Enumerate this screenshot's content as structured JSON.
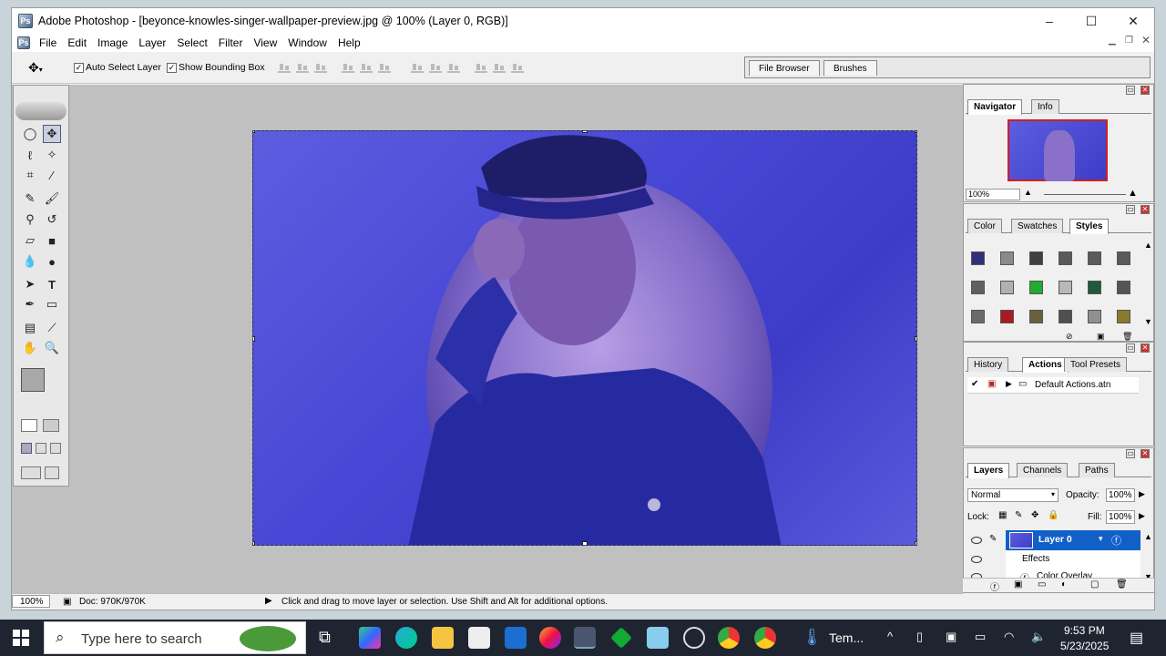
{
  "window": {
    "title": "Adobe Photoshop - [beyonce-knowles-singer-wallpaper-preview.jpg @ 100% (Layer 0, RGB)]",
    "controls": {
      "minimize": "–",
      "maximize": "☐",
      "close": "✕"
    }
  },
  "menu": [
    "File",
    "Edit",
    "Image",
    "Layer",
    "Select",
    "Filter",
    "View",
    "Window",
    "Help"
  ],
  "options": {
    "auto_select_layer": "Auto Select Layer",
    "show_bounding_box": "Show Bounding Box",
    "auto_select_checked": true,
    "show_bbox_checked": true
  },
  "palette_well": {
    "tabs": [
      "File Browser",
      "Brushes"
    ]
  },
  "navigator": {
    "tabs": [
      "Navigator",
      "Info"
    ],
    "zoom": "100%"
  },
  "styles_panel": {
    "tabs": [
      "Color",
      "Swatches",
      "Styles"
    ],
    "swatch_colors": [
      "#30307a",
      "#8a8a8a",
      "#404040",
      "#5a5a5a",
      "#5a5a5a",
      "#5a5a5a",
      "#606060",
      "#b0b0b0",
      "#22aa33",
      "#b8b8b8",
      "#1f5a3a",
      "#555555",
      "#6a6a6a",
      "#aa1a22",
      "#6a6040",
      "#505050",
      "#909090",
      "#8a7a30"
    ]
  },
  "history_panel": {
    "tabs": [
      "History",
      "Actions",
      "Tool Presets"
    ],
    "action_set": "Default Actions.atn"
  },
  "layers_panel": {
    "tabs": [
      "Layers",
      "Channels",
      "Paths"
    ],
    "blend_mode": "Normal",
    "opacity_label": "Opacity:",
    "opacity": "100%",
    "lock_label": "Lock:",
    "fill_label": "Fill:",
    "fill": "100%",
    "layer_name": "Layer 0",
    "effects_label": "Effects",
    "effect_item": "Color Overlay"
  },
  "statusbar": {
    "zoom": "100%",
    "doc": "Doc: 970K/970K",
    "hint": "Click and drag to move layer or selection. Use Shift and Alt for additional options."
  },
  "taskbar": {
    "search_placeholder": "Type here to search",
    "app_label": "Tem...",
    "time": "9:53 PM",
    "date": "5/23/2025"
  }
}
